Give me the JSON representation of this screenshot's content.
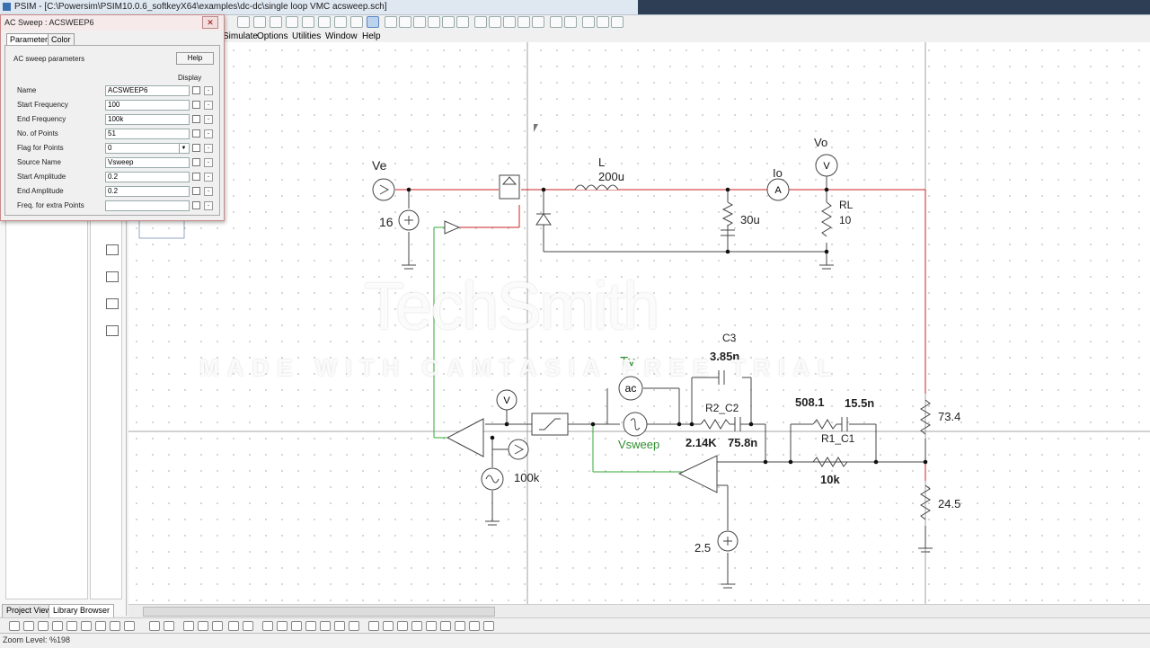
{
  "window": {
    "title": "PSIM - [C:\\Powersim\\PSIM10.0.6_softkeyX64\\examples\\dc-dc\\single loop VMC acsweep.sch]"
  },
  "menu": {
    "items": [
      "Simulate",
      "Options",
      "Utilities",
      "Window",
      "Help"
    ]
  },
  "dialog": {
    "title": "AC Sweep : ACSWEEP6",
    "tabs": [
      "Parameters",
      "Color"
    ],
    "heading": "AC sweep parameters",
    "help_label": "Help",
    "display_label": "Display",
    "close_glyph": "✕",
    "min_glyph": "-",
    "rows": [
      {
        "label": "Name",
        "value": "ACSWEEP6"
      },
      {
        "label": "Start Frequency",
        "value": "100"
      },
      {
        "label": "End Frequency",
        "value": "100k"
      },
      {
        "label": "No. of Points",
        "value": "51"
      },
      {
        "label": "Flag for Points",
        "value": "0"
      },
      {
        "label": "Source Name",
        "value": "Vsweep"
      },
      {
        "label": "Start Amplitude",
        "value": "0.2"
      },
      {
        "label": "End Amplitude",
        "value": "0.2"
      },
      {
        "label": "Freq. for extra Points",
        "value": ""
      }
    ]
  },
  "panel": {
    "tabs": [
      "Project View",
      "Library Browser"
    ],
    "active_tab": "Library Browser"
  },
  "status": {
    "zoom": "Zoom Level: %198"
  },
  "schematic": {
    "labels": {
      "Ve": "Ve",
      "v16": "16",
      "L": "L",
      "L_val": "200u",
      "cap_val": "30u",
      "Io": "Io",
      "Vo": "Vo",
      "RL": "RL",
      "RL_val": "10",
      "C3": "C3",
      "C3_val": "3.85n",
      "Tv": "Tv",
      "ac": "ac",
      "R2_C2": "R2_C2",
      "r2_val": "2.14K",
      "c2_val": "75.8n",
      "Vsweep": "Vsweep",
      "r1_val": "508.1",
      "c1_val": "15.5n",
      "R1_C1": "R1_C1",
      "r_10k": "10k",
      "v73": "73.4",
      "v24": "24.5",
      "v2_5": "2.5",
      "f100k": "100k",
      "meterV": "V",
      "meterA": "A"
    },
    "colors": {
      "power": "#cc2222",
      "control": "#33aa33",
      "wire": "#444444",
      "canvas": "#ffffff"
    }
  },
  "watermark": {
    "logo": "TechSmith",
    "text": "MADE WITH CAMTASIA FREE TRIAL"
  }
}
